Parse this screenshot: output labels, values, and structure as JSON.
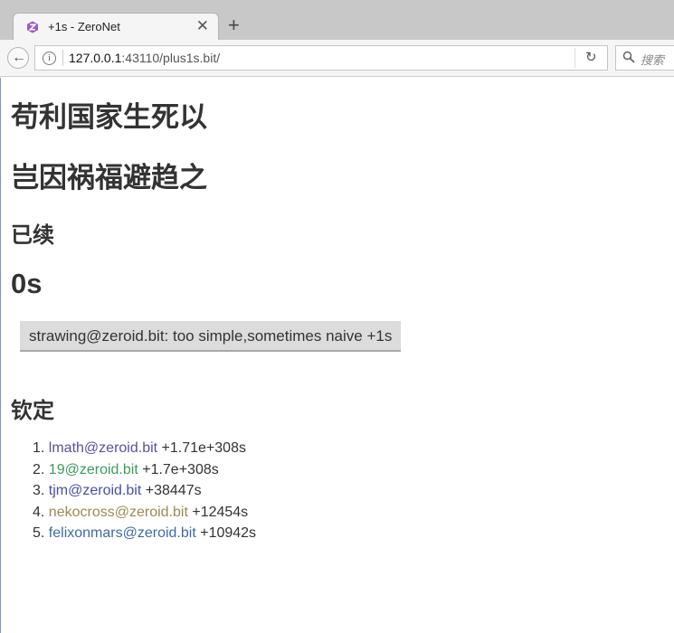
{
  "browser": {
    "tab_title": "+1s - ZeroNet",
    "close_glyph": "✕",
    "new_tab_glyph": "+",
    "url_host": "127.0.0.1",
    "url_rest": ":43110/plus1s.bit/",
    "search_placeholder": "搜索",
    "reload_glyph": "↻",
    "back_glyph": "←",
    "info_glyph": "i",
    "tab_icon": "zeronet-logo-icon",
    "accent_color": "#9b59d0"
  },
  "page": {
    "heading1": "苟利国家生死以",
    "heading2": "岂因祸福避趋之",
    "continued_label": "已续",
    "counter_value": "0s",
    "plus_button_label": "strawing@zeroid.bit: too simple,sometimes naive +1s",
    "ranking_title": "钦定"
  },
  "ranking": [
    {
      "num": "1.",
      "name": "lmath@zeroid.bit",
      "score": "+1.71e+308s",
      "color": "#5b4fa0"
    },
    {
      "num": "2.",
      "name": "19@zeroid.bit",
      "score": "+1.7e+308s",
      "color": "#3f9a5c"
    },
    {
      "num": "3.",
      "name": "tjm@zeroid.bit",
      "score": "+38447s",
      "color": "#4a4fa8"
    },
    {
      "num": "4.",
      "name": "nekocross@zeroid.bit",
      "score": "+12454s",
      "color": "#9a8a52"
    },
    {
      "num": "5.",
      "name": "felixonmars@zeroid.bit",
      "score": "+10942s",
      "color": "#3f6aa8"
    }
  ]
}
